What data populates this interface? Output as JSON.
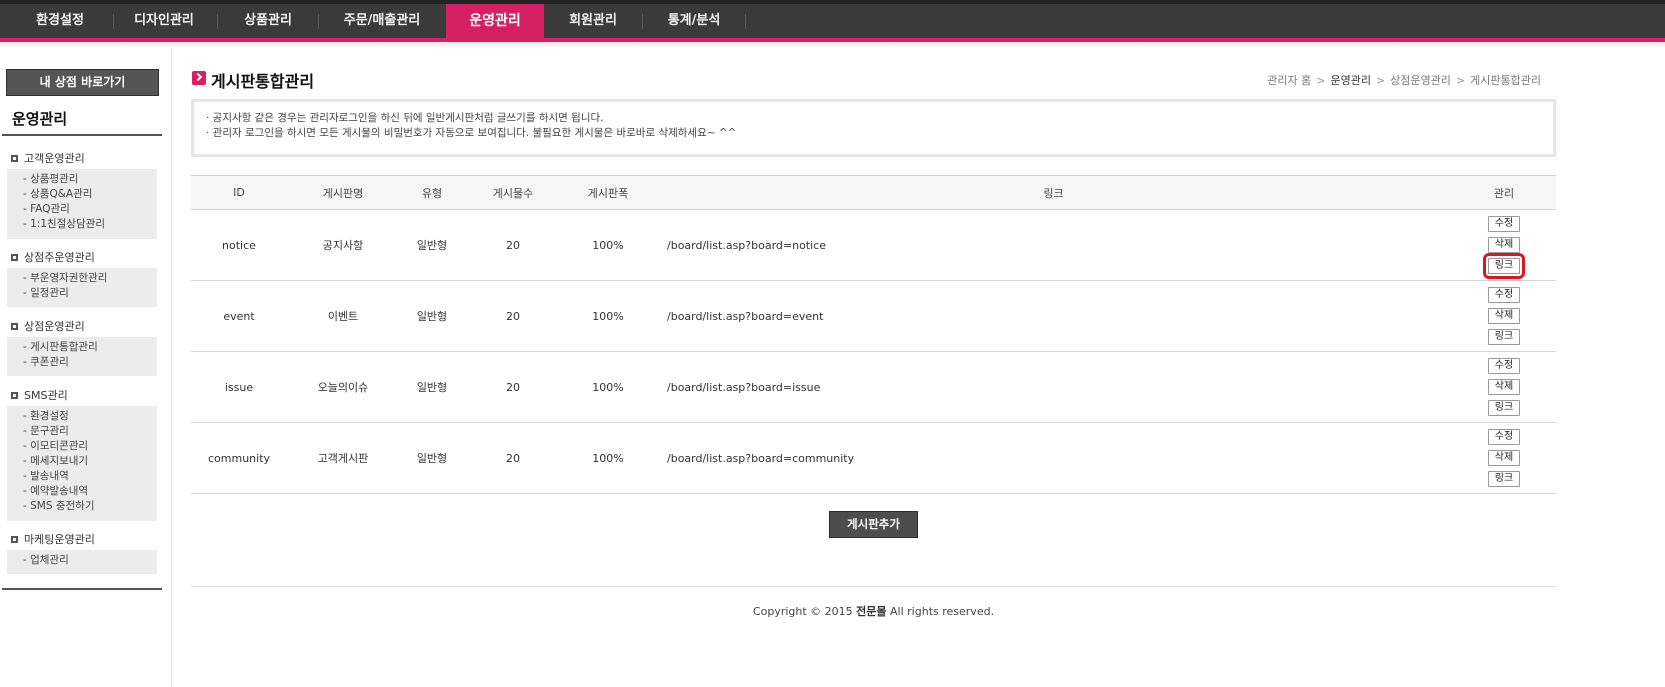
{
  "nav": {
    "items": [
      {
        "label": "환경설정"
      },
      {
        "label": "디자인관리"
      },
      {
        "label": "상품관리"
      },
      {
        "label": "주문/매출관리"
      },
      {
        "label": "운영관리"
      },
      {
        "label": "회원관리"
      },
      {
        "label": "통계/분석"
      }
    ],
    "active": "운영관리"
  },
  "sidebar": {
    "myshop_button": "내 상점 바로가기",
    "title": "운영관리",
    "groups": [
      {
        "label": "고객운영관리",
        "items": [
          "- 상품평관리",
          "- 상품Q&A관리",
          "- FAQ관리",
          "- 1:1친절상담관리"
        ]
      },
      {
        "label": "상점주운영관리",
        "items": [
          "- 부운영자권한관리",
          "- 일정관리"
        ]
      },
      {
        "label": "상점운영관리",
        "items": [
          "- 게시판통합관리",
          "- 쿠폰관리"
        ]
      },
      {
        "label": "SMS관리",
        "items": [
          "- 환경설정",
          "- 문구관리",
          "- 이모티콘관리",
          "- 메세지보내기",
          "- 발송내역",
          "- 예약발송내역",
          "- SMS 충전하기"
        ]
      },
      {
        "label": "마케팅운영관리",
        "items": [
          "- 업체관리"
        ]
      }
    ]
  },
  "page": {
    "title": "게시판통합관리",
    "breadcrumb": [
      "관리자 홈",
      "운영관리",
      "상점운영관리",
      "게시판통합관리"
    ]
  },
  "notice": {
    "lines": [
      "· 공지사항 같은 경우는 관리자로그인을 하신 뒤에 일반게시판처럼 글쓰기를 하시면 됩니다.",
      "· 관리자 로그인을 하시면 모든 게시물의 비밀번호가 자동으로 보여집니다. 불필요한 게시물은 바로바로 삭제하세요~ ^^"
    ]
  },
  "table": {
    "headers": [
      "ID",
      "게시판명",
      "유형",
      "게시물수",
      "게시판폭",
      "링크",
      "관리"
    ],
    "rows": [
      {
        "id": "notice",
        "name": "공지사항",
        "type": "일반형",
        "count": "20",
        "width": "100%",
        "link": "/board/list.asp?board=notice"
      },
      {
        "id": "event",
        "name": "이벤트",
        "type": "일반형",
        "count": "20",
        "width": "100%",
        "link": "/board/list.asp?board=event"
      },
      {
        "id": "issue",
        "name": "오늘의이슈",
        "type": "일반형",
        "count": "20",
        "width": "100%",
        "link": "/board/list.asp?board=issue"
      },
      {
        "id": "community",
        "name": "고객게시판",
        "type": "일반형",
        "count": "20",
        "width": "100%",
        "link": "/board/list.asp?board=community"
      }
    ],
    "buttons": {
      "edit": "수정",
      "delete": "삭제",
      "link": "링크"
    }
  },
  "add_button": "게시판추가",
  "footer": {
    "prefix": "Copyright © 2015 ",
    "brand": "전문몰",
    "suffix": " All rights reserved."
  }
}
